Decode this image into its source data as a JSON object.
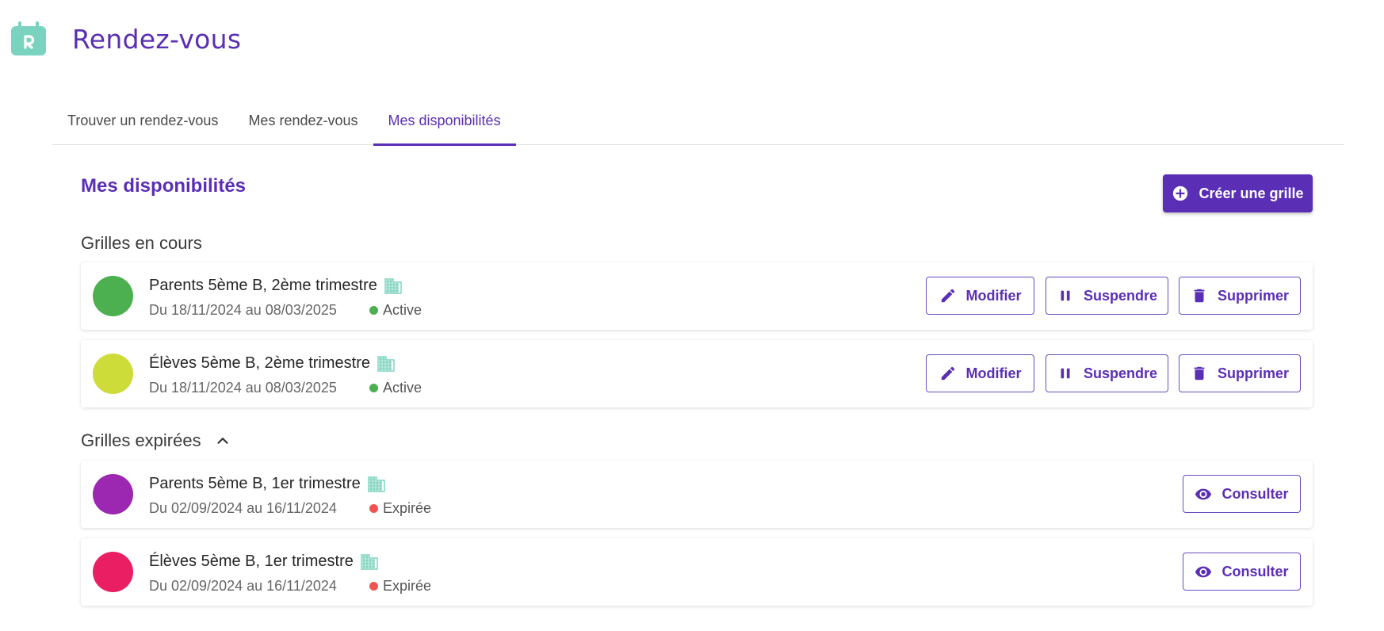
{
  "app": {
    "title": "Rendez-vous",
    "brand_color": "#5b2fb5",
    "logo_color": "#7ad3be"
  },
  "tabs": [
    {
      "label": "Trouver un rendez-vous",
      "active": false
    },
    {
      "label": "Mes rendez-vous",
      "active": false
    },
    {
      "label": "Mes disponibilités",
      "active": true
    }
  ],
  "page": {
    "title": "Mes disponibilités",
    "create_label": "Créer une grille"
  },
  "groups": {
    "current_title": "Grilles en cours",
    "expired_title": "Grilles expirées"
  },
  "current": [
    {
      "name": "Parents 5ème B, 2ème trimestre",
      "dates": "Du 18/11/2024 au 08/03/2025",
      "status": "Active",
      "color": "#4caf50",
      "status_color": "#4caf50",
      "edit_label": "Modifier",
      "suspend_label": "Suspendre",
      "delete_label": "Supprimer"
    },
    {
      "name": "Élèves 5ème B, 2ème trimestre",
      "dates": "Du 18/11/2024 au 08/03/2025",
      "status": "Active",
      "color": "#cddc39",
      "status_color": "#4caf50",
      "edit_label": "Modifier",
      "suspend_label": "Suspendre",
      "delete_label": "Supprimer"
    }
  ],
  "expired": [
    {
      "name": "Parents 5ème B, 1er trimestre",
      "dates": "Du 02/09/2024 au 16/11/2024",
      "status": "Expirée",
      "color": "#9c27b0",
      "status_color": "#ef5350",
      "view_label": "Consulter"
    },
    {
      "name": "Élèves 5ème B, 1er trimestre",
      "dates": "Du 02/09/2024 au 16/11/2024",
      "status": "Expirée",
      "color": "#e91e63",
      "status_color": "#ef5350",
      "view_label": "Consulter"
    }
  ]
}
